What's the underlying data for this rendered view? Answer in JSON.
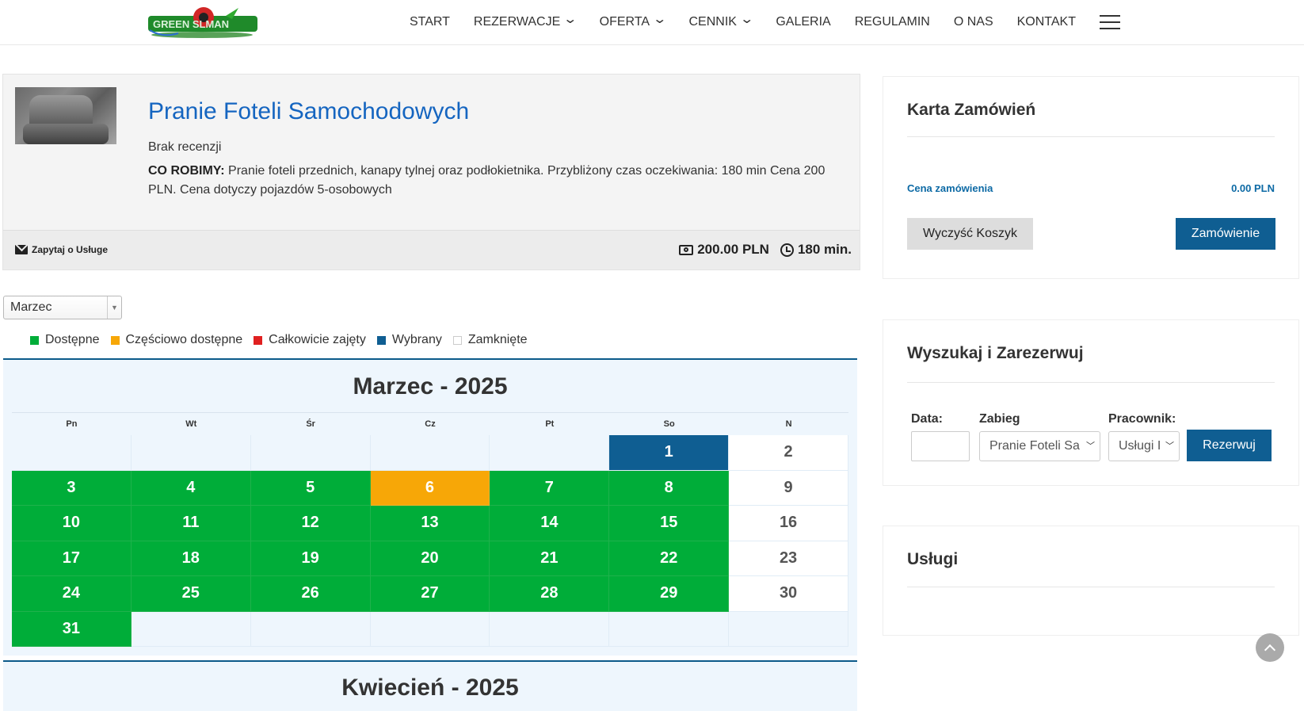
{
  "header": {
    "logo_alt": "GreenSlman",
    "nav": [
      {
        "label": "START",
        "has_dropdown": false
      },
      {
        "label": "REZERWACJE",
        "has_dropdown": true
      },
      {
        "label": "OFERTA",
        "has_dropdown": true
      },
      {
        "label": "CENNIK",
        "has_dropdown": true
      },
      {
        "label": "GALERIA",
        "has_dropdown": false
      },
      {
        "label": "REGULAMIN",
        "has_dropdown": false
      },
      {
        "label": "O NAS",
        "has_dropdown": false
      },
      {
        "label": "KONTAKT",
        "has_dropdown": false
      }
    ]
  },
  "service": {
    "title": "Pranie Foteli Samochodowych",
    "reviews": "Brak recenzji",
    "desc_label": "CO ROBIMY:",
    "desc_text": " Pranie foteli przednich, kanapy tylnej oraz podłokietnika. Przybliżony czas oczekiwania: 180 min Cena 200 PLN. Cena dotyczy pojazdów 5-osobowych",
    "ask_label": "Zapytaj o Usługe",
    "price": "200.00 PLN",
    "duration": "180 min."
  },
  "month_select": {
    "value": "Marzec"
  },
  "legend": [
    {
      "label": "Dostępne",
      "color": "#00ad39"
    },
    {
      "label": "Częściowo dostępne",
      "color": "#f7a707"
    },
    {
      "label": "Całkowicie zajęty",
      "color": "#e02020"
    },
    {
      "label": "Wybrany",
      "color": "#0f5e92"
    },
    {
      "label": "Zamknięte",
      "color": "#ffffff"
    }
  ],
  "calendar": {
    "weekdays": [
      "Pn",
      "Wt",
      "Śr",
      "Cz",
      "Pt",
      "So",
      "N"
    ],
    "march": {
      "title": "Marzec - 2025",
      "weeks": [
        [
          null,
          null,
          null,
          null,
          null,
          {
            "d": "1",
            "s": "selected"
          },
          {
            "d": "2",
            "s": "closed"
          }
        ],
        [
          {
            "d": "3",
            "s": "available"
          },
          {
            "d": "4",
            "s": "available"
          },
          {
            "d": "5",
            "s": "available"
          },
          {
            "d": "6",
            "s": "partial"
          },
          {
            "d": "7",
            "s": "available"
          },
          {
            "d": "8",
            "s": "available"
          },
          {
            "d": "9",
            "s": "closed"
          }
        ],
        [
          {
            "d": "10",
            "s": "available"
          },
          {
            "d": "11",
            "s": "available"
          },
          {
            "d": "12",
            "s": "available"
          },
          {
            "d": "13",
            "s": "available"
          },
          {
            "d": "14",
            "s": "available"
          },
          {
            "d": "15",
            "s": "available"
          },
          {
            "d": "16",
            "s": "closed"
          }
        ],
        [
          {
            "d": "17",
            "s": "available"
          },
          {
            "d": "18",
            "s": "available"
          },
          {
            "d": "19",
            "s": "available"
          },
          {
            "d": "20",
            "s": "available"
          },
          {
            "d": "21",
            "s": "available"
          },
          {
            "d": "22",
            "s": "available"
          },
          {
            "d": "23",
            "s": "closed"
          }
        ],
        [
          {
            "d": "24",
            "s": "available"
          },
          {
            "d": "25",
            "s": "available"
          },
          {
            "d": "26",
            "s": "available"
          },
          {
            "d": "27",
            "s": "available"
          },
          {
            "d": "28",
            "s": "available"
          },
          {
            "d": "29",
            "s": "available"
          },
          {
            "d": "30",
            "s": "closed"
          }
        ],
        [
          {
            "d": "31",
            "s": "available"
          },
          null,
          null,
          null,
          null,
          null,
          null
        ]
      ]
    },
    "april": {
      "title": "Kwiecień - 2025"
    }
  },
  "order_card": {
    "title": "Karta Zamówień",
    "price_label": "Cena zamówienia",
    "price_value": "0.00 PLN",
    "clear_label": "Wyczyść Koszyk",
    "order_label": "Zamówienie"
  },
  "search": {
    "title": "Wyszukaj i Zarezerwuj",
    "date_label": "Data:",
    "date_value": "",
    "treatment_label": "Zabieg",
    "treatment_value": "Pranie Foteli Sa",
    "employee_label": "Pracownik:",
    "employee_value": "Usługi I",
    "reserve_label": "Rezerwuj"
  },
  "services_widget": {
    "title": "Usługi"
  }
}
